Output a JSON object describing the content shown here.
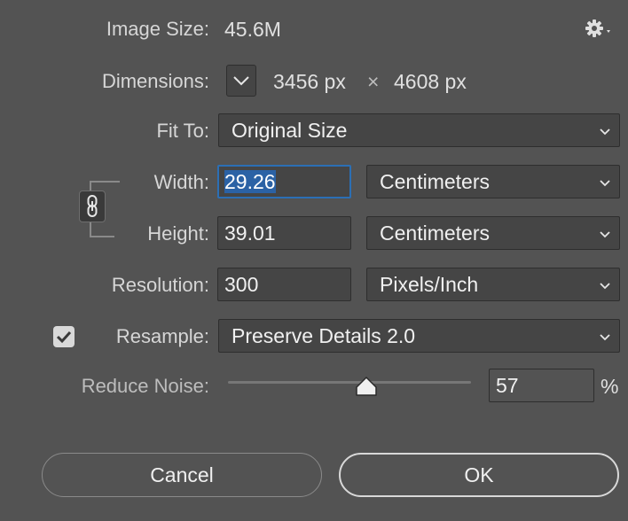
{
  "image_size": {
    "label": "Image Size:",
    "value": "45.6M"
  },
  "dimensions": {
    "label": "Dimensions:",
    "width": "3456 px",
    "times": "×",
    "height": "4608 px"
  },
  "fit_to": {
    "label": "Fit To:",
    "value": "Original Size"
  },
  "width": {
    "label": "Width:",
    "value": "29.26",
    "unit": "Centimeters"
  },
  "height": {
    "label": "Height:",
    "value": "39.01",
    "unit": "Centimeters"
  },
  "resolution": {
    "label": "Resolution:",
    "value": "300",
    "unit": "Pixels/Inch"
  },
  "resample": {
    "label": "Resample:",
    "checked": true,
    "value": "Preserve Details 2.0"
  },
  "reduce_noise": {
    "label": "Reduce Noise:",
    "value": "57",
    "unit": "%",
    "level_percent": 57
  },
  "buttons": {
    "cancel": "Cancel",
    "ok": "OK"
  },
  "icons": {
    "settings": "gear-icon",
    "link": "chain-link-icon",
    "dimensions_toggle": "chevron-down-icon"
  }
}
